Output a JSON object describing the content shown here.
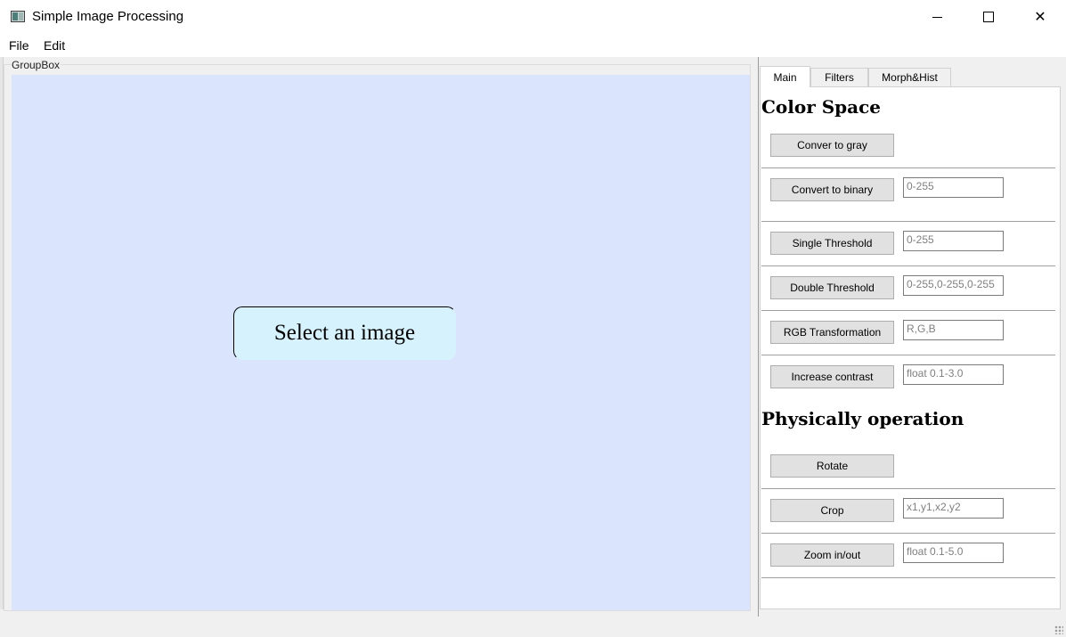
{
  "window": {
    "title": "Simple Image Processing",
    "close_glyph": "✕"
  },
  "menu": {
    "file": "File",
    "edit": "Edit"
  },
  "groupbox": {
    "title": "GroupBox",
    "select_label": "Select an image"
  },
  "tabs": [
    "Main",
    "Filters",
    "Morph&Hist"
  ],
  "color_space": {
    "title": "Color Space",
    "gray_label": "Conver to gray",
    "binary_label": "Convert to binary",
    "binary_placeholder": "0-255",
    "single_label": "Single Threshold",
    "single_placeholder": "0-255",
    "double_label": "Double Threshold",
    "double_placeholder": "0-255,0-255,0-255",
    "rgb_label": "RGB Transformation",
    "rgb_placeholder": "R,G,B",
    "contrast_label": "Increase contrast",
    "contrast_placeholder": "float 0.1-3.0"
  },
  "physical": {
    "title": "Physically operation",
    "rotate_label": "Rotate",
    "crop_label": "Crop",
    "crop_placeholder": "x1,y1,x2,y2",
    "zoom_label": "Zoom in/out",
    "zoom_placeholder": "float 0.1-5.0"
  }
}
